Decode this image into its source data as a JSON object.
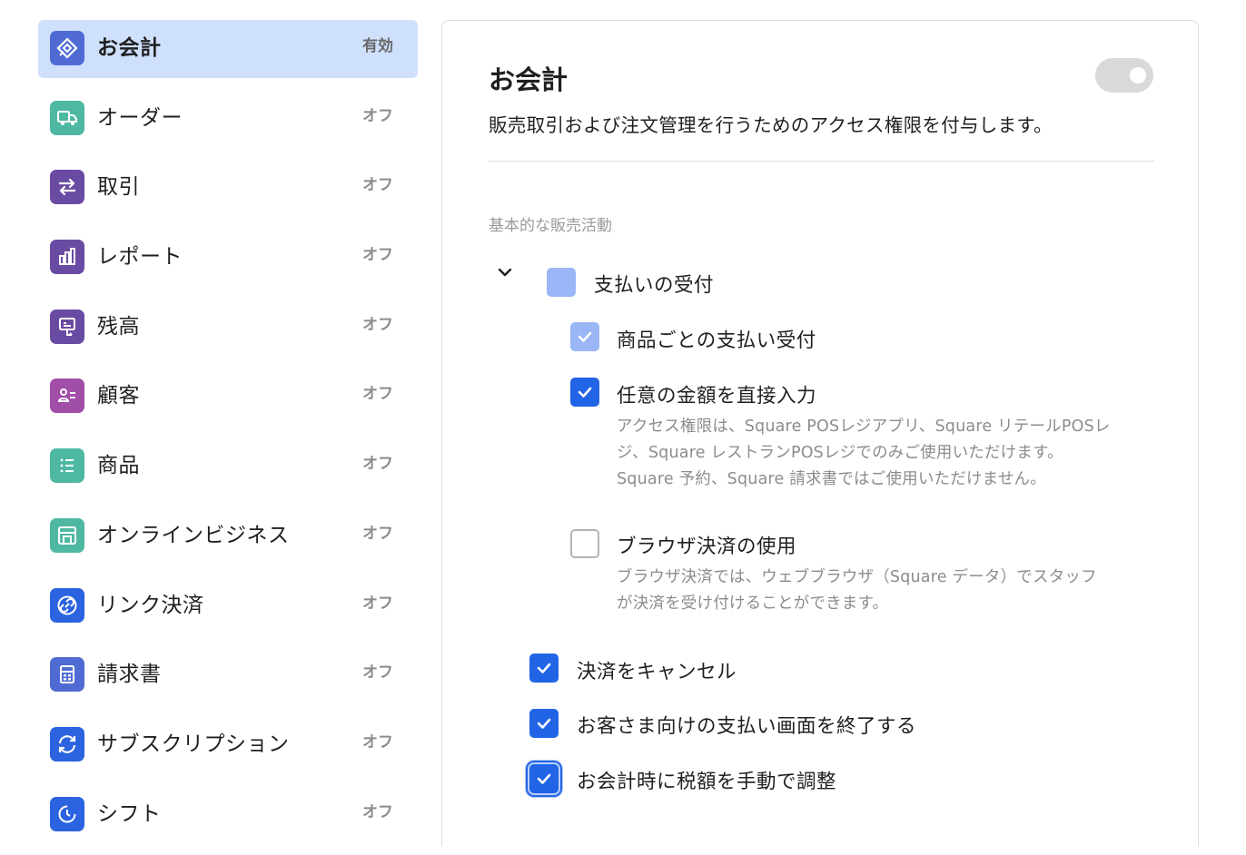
{
  "sidebar": {
    "items": [
      {
        "label": "お会計",
        "status": "有効",
        "icon": "diamond-tag-icon",
        "color": "#4f6bd3",
        "active": true
      },
      {
        "label": "オーダー",
        "status": "オフ",
        "icon": "delivery-truck-icon",
        "color": "#4fb8a3"
      },
      {
        "label": "取引",
        "status": "オフ",
        "icon": "swap-arrows-icon",
        "color": "#6a4ba3"
      },
      {
        "label": "レポート",
        "status": "オフ",
        "icon": "bar-chart-icon",
        "color": "#6a4ba3"
      },
      {
        "label": "残高",
        "status": "オフ",
        "icon": "balance-screen-icon",
        "color": "#6a4ba3"
      },
      {
        "label": "顧客",
        "status": "オフ",
        "icon": "customer-card-icon",
        "color": "#a04ea8"
      },
      {
        "label": "商品",
        "status": "オフ",
        "icon": "item-list-icon",
        "color": "#4fb8a3"
      },
      {
        "label": "オンラインビジネス",
        "status": "オフ",
        "icon": "storefront-icon",
        "color": "#4fb8a3"
      },
      {
        "label": "リンク決済",
        "status": "オフ",
        "icon": "link-circle-icon",
        "color": "#2b63e0"
      },
      {
        "label": "請求書",
        "status": "オフ",
        "icon": "invoice-calculator-icon",
        "color": "#4f6bd3"
      },
      {
        "label": "サブスクリプション",
        "status": "オフ",
        "icon": "refresh-cycle-icon",
        "color": "#2b63e0"
      },
      {
        "label": "シフト",
        "status": "オフ",
        "icon": "shift-clock-icon",
        "color": "#2b63e0"
      }
    ]
  },
  "panel": {
    "title": "お会計",
    "toggle_on": false,
    "description": "販売取引および注文管理を行うためのアクセス権限を付与します。",
    "section_heading": "基本的な販売活動",
    "group": {
      "label": "支払いの受付",
      "expanded": true,
      "options": [
        {
          "label": "商品ごとの支払い受付",
          "state": "checked-disabled"
        },
        {
          "label": "任意の金額を直接入力",
          "state": "checked",
          "help": [
            "アクセス権限は、Square POSレジアプリ、Square リテールPOSレ",
            "ジ、Square レストランPOSレジでのみご使用いただけます。",
            "Square 予約、Square 請求書ではご使用いただけません。"
          ]
        },
        {
          "label": "ブラウザ決済の使用",
          "state": "unchecked",
          "help": [
            "ブラウザ決済では、ウェブブラウザ（Square データ）でスタッフ",
            "が決済を受け付けることができます。"
          ]
        }
      ]
    },
    "options": [
      {
        "label": "決済をキャンセル",
        "state": "checked"
      },
      {
        "label": "お客さま向けの支払い画面を終了する",
        "state": "checked"
      },
      {
        "label": "お会計時に税額を手動で調整",
        "state": "checked-focused"
      }
    ]
  },
  "colors": {
    "accent": "#2264e6",
    "active_bg": "#cfe0fd",
    "muted_text": "#8c8c8c"
  }
}
